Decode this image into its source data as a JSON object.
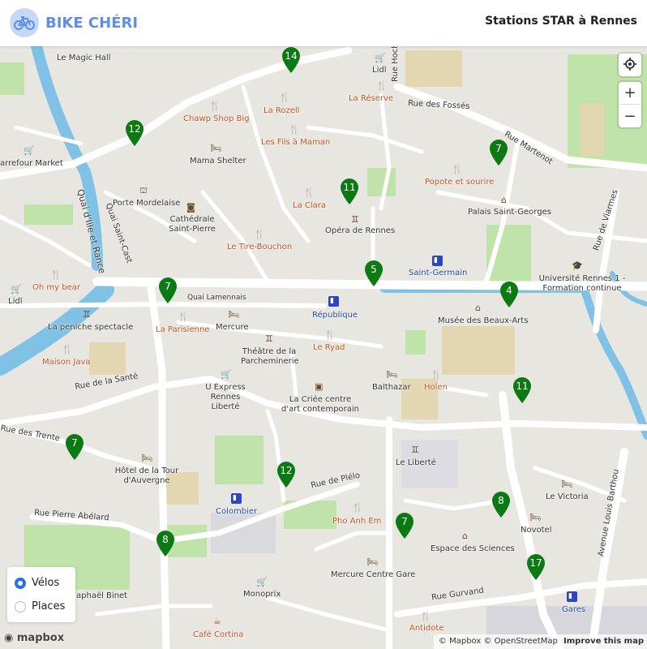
{
  "header": {
    "brand": "BIKE CHÉRI",
    "title": "Stations STAR à Rennes"
  },
  "colors": {
    "brand": "#5f8ee8",
    "station": "#0b7a13",
    "water": "#7fc2e6",
    "park": "#bfe3a8",
    "road": "#ffffff",
    "radio": "#2b6fe6"
  },
  "map": {
    "poi_labels": [
      {
        "text": "Le Magic Hall",
        "kind": "poi"
      },
      {
        "text": "Lidl",
        "kind": "poi"
      },
      {
        "text": "Rue Hoche",
        "kind": "road"
      },
      {
        "text": "Rue des Fossés",
        "kind": "road"
      },
      {
        "text": "La Rozell",
        "kind": "rest"
      },
      {
        "text": "La Réserve",
        "kind": "rest"
      },
      {
        "text": "Chawp Shop Big",
        "kind": "rest"
      },
      {
        "text": "Les Fils à Maman",
        "kind": "rest"
      },
      {
        "text": "Rue Martenot",
        "kind": "road"
      },
      {
        "text": "arrefour Market",
        "kind": "poi"
      },
      {
        "text": "Mama Shelter",
        "kind": "poi"
      },
      {
        "text": "Popote et sourire",
        "kind": "rest"
      },
      {
        "text": "Quai Saint-Cast",
        "kind": "road"
      },
      {
        "text": "Porte Mordelaise",
        "kind": "poi"
      },
      {
        "text": "La Clara",
        "kind": "rest"
      },
      {
        "text": "Palais Saint-Georges",
        "kind": "poi"
      },
      {
        "text": "Quai d'Ille et Rance",
        "kind": "road"
      },
      {
        "text": "Cathédrale Saint-Pierre",
        "kind": "poi"
      },
      {
        "text": "Opéra de Rennes",
        "kind": "poi"
      },
      {
        "text": "Rue de Viarmes",
        "kind": "road"
      },
      {
        "text": "Le Tire-Bouchon",
        "kind": "rest"
      },
      {
        "text": "Saint-Germain",
        "kind": "blue"
      },
      {
        "text": "Université Rennes 1 - Formation continue",
        "kind": "poi"
      },
      {
        "text": "Oh my bear",
        "kind": "rest"
      },
      {
        "text": "Lidl",
        "kind": "poi"
      },
      {
        "text": "Quai Lamennais",
        "kind": "road"
      },
      {
        "text": "République",
        "kind": "blue"
      },
      {
        "text": "Mercure",
        "kind": "poi"
      },
      {
        "text": "La Parisienne",
        "kind": "rest"
      },
      {
        "text": "La peniche spectacle",
        "kind": "poi"
      },
      {
        "text": "Musée des Beaux-Arts",
        "kind": "poi"
      },
      {
        "text": "Théâtre de la Parcheminerie",
        "kind": "poi"
      },
      {
        "text": "Le Ryad",
        "kind": "rest"
      },
      {
        "text": "Maison Java",
        "kind": "rest"
      },
      {
        "text": "Rue de la Santé",
        "kind": "road"
      },
      {
        "text": "U Express Rennes Liberté",
        "kind": "poi"
      },
      {
        "text": "Balthazar",
        "kind": "poi"
      },
      {
        "text": "Holen",
        "kind": "rest"
      },
      {
        "text": "La Criée centre d'art contemporain",
        "kind": "poi"
      },
      {
        "text": "Rue des Trente",
        "kind": "road"
      },
      {
        "text": "Le Liberté",
        "kind": "poi"
      },
      {
        "text": "Hôtel de la Tour d'Auvergne",
        "kind": "poi"
      },
      {
        "text": "Rue de Plélo",
        "kind": "road"
      },
      {
        "text": "Colombier",
        "kind": "blue"
      },
      {
        "text": "Le Victoria",
        "kind": "poi"
      },
      {
        "text": "Avenue Louis Barthou",
        "kind": "road"
      },
      {
        "text": "Rue Pierre Abélard",
        "kind": "road"
      },
      {
        "text": "Pho Anh Em",
        "kind": "rest"
      },
      {
        "text": "Novotel",
        "kind": "poi"
      },
      {
        "text": "Espace des Sciences",
        "kind": "poi"
      },
      {
        "text": "Mercure Centre Gare",
        "kind": "poi"
      },
      {
        "text": "aphaël Binet",
        "kind": "road"
      },
      {
        "text": "Rue Gurvand",
        "kind": "road"
      },
      {
        "text": "Monoprix",
        "kind": "poi"
      },
      {
        "text": "Gares",
        "kind": "blue"
      },
      {
        "text": "Café Cortina",
        "kind": "rest"
      },
      {
        "text": "Antidote",
        "kind": "rest"
      }
    ],
    "stations": [
      "14",
      "12",
      "7",
      "11",
      "5",
      "7",
      "4",
      "11",
      "7",
      "12",
      "8",
      "7",
      "8",
      "17"
    ],
    "controls": {
      "locate": "locate-icon",
      "zoom_in": "+",
      "zoom_out": "−"
    },
    "attribution": "© Mapbox © OpenStreetMap",
    "improve": "Improve this map",
    "logo": "mapbox"
  },
  "layer_toggle": {
    "options": [
      {
        "label": "Vélos",
        "selected": true
      },
      {
        "label": "Places",
        "selected": false
      }
    ]
  }
}
